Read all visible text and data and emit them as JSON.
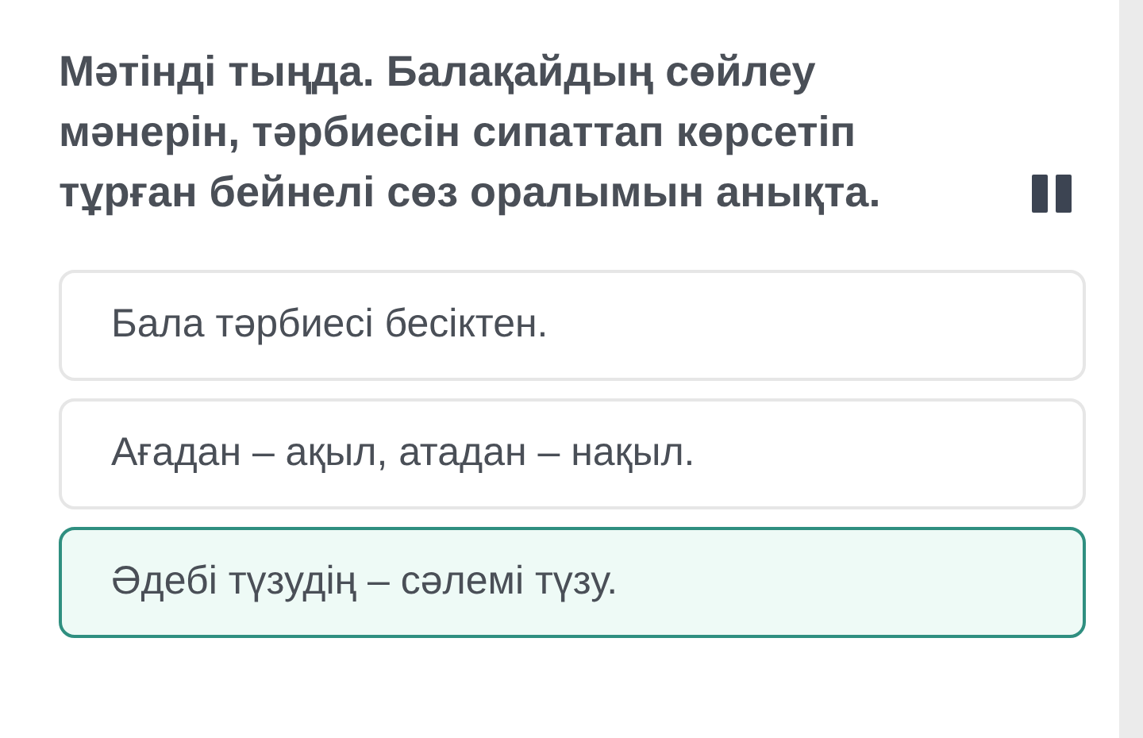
{
  "question": "Мәтінді тыңда. Балақайдың сөйлеу мәнерін, тәрбиесін сипаттап көрсетіп тұрған бейнелі сөз оралымын анықта.",
  "options": [
    {
      "label": "Бала тәрбиесі бесіктен.",
      "selected": false
    },
    {
      "label": "Ағадан – ақыл, атадан – нақыл.",
      "selected": false
    },
    {
      "label": "Әдебі түзудің – сәлемі түзу.",
      "selected": true
    }
  ]
}
